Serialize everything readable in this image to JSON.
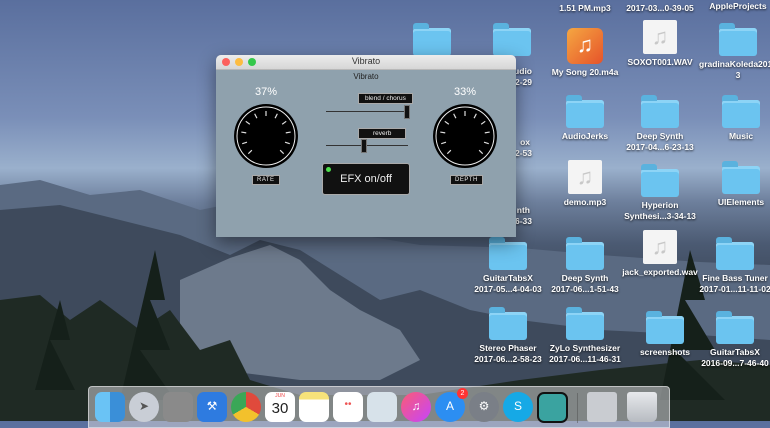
{
  "desktop": {
    "icons": [
      {
        "label": "1.51 PM.mp3",
        "kind": "partial"
      },
      {
        "label": "2017-03...0-39-05",
        "kind": "partial"
      },
      {
        "label": "AppleProjects",
        "kind": "partial"
      },
      {
        "label": "",
        "kind": "folder"
      },
      {
        "label": "",
        "kind": "folder"
      },
      {
        "label": "Audio",
        "kind": "partial"
      },
      {
        "label": "-42-29",
        "kind": "partial"
      },
      {
        "label": "My Song 20.m4a",
        "kind": "garageband"
      },
      {
        "label": "SOXOT001.WAV",
        "kind": "audio"
      },
      {
        "label": "gradinaKoleda2017",
        "kind": "folder"
      },
      {
        "label": "3",
        "kind": "partial"
      },
      {
        "label": "ox",
        "kind": "partial"
      },
      {
        "label": "-42-53",
        "kind": "partial"
      },
      {
        "label": "AudioJerks",
        "kind": "folder"
      },
      {
        "label": "Deep Synth",
        "kind": "folder"
      },
      {
        "label": "2017-04...6-23-13",
        "kind": "partial"
      },
      {
        "label": "Music",
        "kind": "folder"
      },
      {
        "label": "nth",
        "kind": "partial"
      },
      {
        "label": "-36-33",
        "kind": "partial"
      },
      {
        "label": "demo.mp3",
        "kind": "audio"
      },
      {
        "label": "Hyperion",
        "kind": "folder"
      },
      {
        "label": "Synthesi...3-34-13",
        "kind": "partial"
      },
      {
        "label": "UIElements",
        "kind": "folder"
      },
      {
        "label": "GuitarTabsX",
        "kind": "folder"
      },
      {
        "label": "2017-05...4-04-03",
        "kind": "partial"
      },
      {
        "label": "Deep Synth",
        "kind": "folder"
      },
      {
        "label": "2017-06...1-51-43",
        "kind": "partial"
      },
      {
        "label": "jack_exported.wav",
        "kind": "audio"
      },
      {
        "label": "Fine Bass Tuner",
        "kind": "folder"
      },
      {
        "label": "2017-01...11-11-02",
        "kind": "partial"
      },
      {
        "label": "Stereo Phaser",
        "kind": "folder"
      },
      {
        "label": "2017-06...2-58-23",
        "kind": "partial"
      },
      {
        "label": "ZyLo Synthesizer",
        "kind": "folder"
      },
      {
        "label": "2017-06...11-46-31",
        "kind": "partial"
      },
      {
        "label": "screenshots",
        "kind": "folder"
      },
      {
        "label": "GuitarTabsX",
        "kind": "folder"
      },
      {
        "label": "2016-09...7-46-40",
        "kind": "partial"
      }
    ]
  },
  "window": {
    "title": "Vibrato",
    "subtitle": "Vibrato",
    "rate_percent": "37%",
    "depth_percent": "33%",
    "rate_label": "RATE",
    "depth_label": "DEPTH",
    "rate_value": 0.37,
    "depth_value": 0.33,
    "blend_label": "blend / chorus",
    "blend_value": 1.0,
    "reverb_label": "reverb",
    "reverb_value": 0.45,
    "efx_label": "EFX on/off",
    "efx_on": true
  },
  "dock": {
    "calendar_month": "JUN",
    "calendar_day": "30",
    "appstore_badge": "2"
  },
  "colors": {
    "window_bg": "#8fa1ad",
    "led_green": "#4ee04e",
    "folder_blue": "#6bc4f0"
  }
}
